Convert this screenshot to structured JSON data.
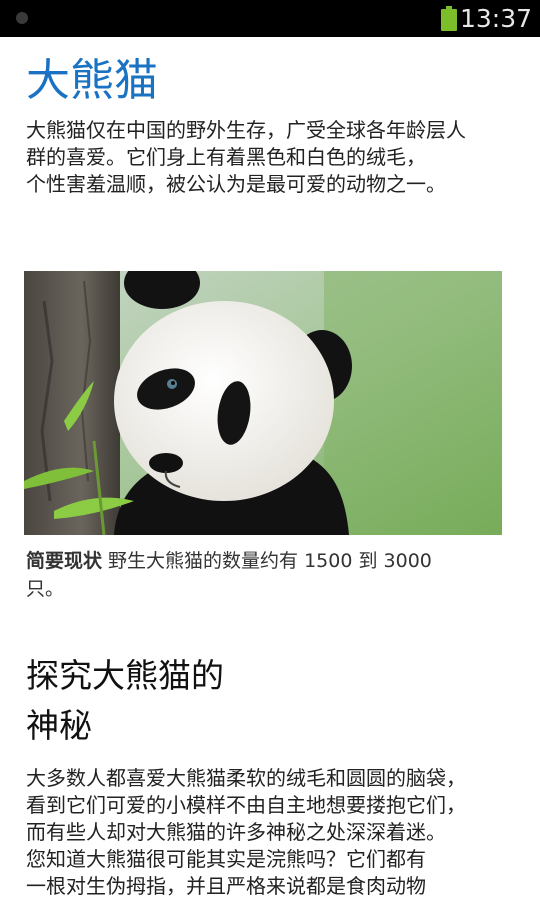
{
  "status_bar": {
    "time": "13:37",
    "icons": [
      "notification-dot-icon",
      "battery-icon"
    ],
    "battery_color": "#7cbd2a"
  },
  "article": {
    "title": "大熊猫",
    "title_color": "#1a72c2",
    "intro": "大熊猫仅在中国的野外生存，广受全球各年龄层人\n群的喜爱。它们身上有着黑色和白色的绒毛，\n个性害羞温顺，被公认为是最可爱的动物之一。",
    "image_subject": "giant panda peeking from behind a tree trunk",
    "caption_label": "简要现状",
    "caption_text": " 野生大熊猫的数量约有 1500 到 3000 只。",
    "section_heading": "探究大熊猫的\n神秘",
    "body": "大多数人都喜爱大熊猫柔软的绒毛和圆圆的脑袋，\n看到它们可爱的小模样不由自主地想要搂抱它们，\n而有些人却对大熊猫的许多神秘之处深深着迷。\n您知道大熊猫很可能其实是浣熊吗？它们都有\n一根对生伪拇指，并且严格来说都是食肉动物"
  }
}
